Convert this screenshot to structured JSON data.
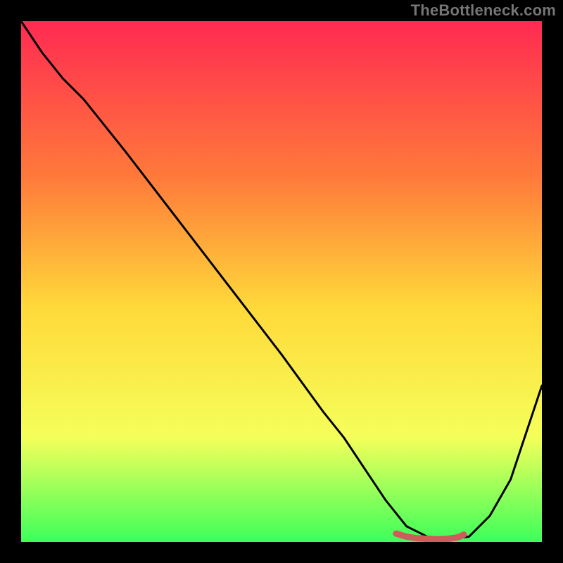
{
  "watermark": "TheBottleneck.com",
  "colors": {
    "background_black": "#000000",
    "grad_top": "#ff2a52",
    "grad_mid_upper": "#ff7a3a",
    "grad_mid": "#ffd93a",
    "grad_lower": "#f5ff5a",
    "grad_bottom": "#3cff5a",
    "curve": "#000000",
    "marker": "#cf5b5b"
  },
  "chart_data": {
    "type": "line",
    "title": "",
    "xlabel": "",
    "ylabel": "",
    "xlim": [
      0,
      100
    ],
    "ylim": [
      0,
      100
    ],
    "series": [
      {
        "name": "bottleneck-curve",
        "x": [
          0,
          4,
          8,
          12,
          20,
          30,
          40,
          50,
          58,
          62,
          66,
          70,
          74,
          78,
          82,
          86,
          90,
          94,
          100
        ],
        "y": [
          100,
          94,
          89,
          85,
          75,
          62,
          49,
          36,
          25,
          20,
          14,
          8,
          3,
          1,
          0.5,
          1,
          5,
          12,
          30
        ]
      },
      {
        "name": "optimal-zone-marker",
        "x": [
          72,
          74,
          76,
          78,
          80,
          82,
          84,
          85
        ],
        "y": [
          1.6,
          1.0,
          0.7,
          0.6,
          0.5,
          0.6,
          0.9,
          1.4
        ]
      }
    ],
    "annotations": []
  }
}
